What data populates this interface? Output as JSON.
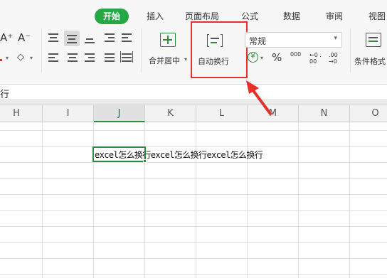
{
  "ribbon": {
    "tabs": [
      {
        "label": "开始",
        "active": true
      },
      {
        "label": "插入",
        "active": false
      },
      {
        "label": "页面布局",
        "active": false
      },
      {
        "label": "公式",
        "active": false
      },
      {
        "label": "数据",
        "active": false
      },
      {
        "label": "审阅",
        "active": false
      },
      {
        "label": "视图",
        "active": false
      }
    ],
    "font": {
      "increase_label": "A⁺",
      "decrease_label": "A⁻"
    },
    "merge_label": "合并居中",
    "wrap_label": "自动换行",
    "number_format": {
      "value": "常规"
    },
    "percent_label": "%",
    "thousands_label": "000",
    "dec_inc_label": "←0 .00",
    "dec_dec_label": ".00 →0",
    "cond_format_label": "条件格式"
  },
  "formula_bar": {
    "text": "行"
  },
  "columns": [
    {
      "label": "H",
      "selected": false
    },
    {
      "label": "I",
      "selected": false
    },
    {
      "label": "J",
      "selected": true
    },
    {
      "label": "K",
      "selected": false
    },
    {
      "label": "L",
      "selected": false
    },
    {
      "label": "M",
      "selected": false
    },
    {
      "label": "N",
      "selected": false
    },
    {
      "label": "O",
      "selected": false
    }
  ],
  "cell": {
    "text": "excel怎么换行excel怎么换行excel怎么换行"
  },
  "colors": {
    "accent": "#26a745",
    "highlight": "#e5302a",
    "selection": "#2f8a3e"
  }
}
